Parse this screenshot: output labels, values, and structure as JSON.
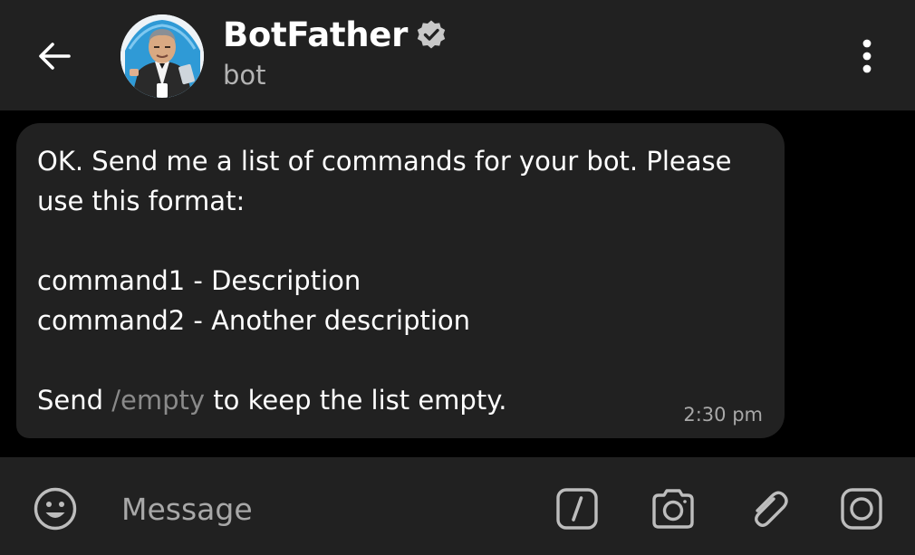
{
  "header": {
    "back_icon": "arrow-left-icon",
    "title": "BotFather",
    "verified_icon": "verified-badge-icon",
    "subtitle": "bot",
    "menu_icon": "more-vertical-icon"
  },
  "message": {
    "lines": [
      "OK. Send me a list of commands for your bot. Please",
      "use this format:",
      "",
      "command1 - Description",
      "command2 - Another description",
      ""
    ],
    "last_line": {
      "before": "Send ",
      "command": "/empty",
      "after": " to keep the list empty."
    },
    "time": "2:30 pm"
  },
  "input_bar": {
    "emoji_icon": "emoji-icon",
    "placeholder": "Message",
    "value": "",
    "commands_icon": "slash-commands-icon",
    "camera_icon": "camera-icon",
    "attach_icon": "paperclip-icon",
    "video_message_icon": "video-message-icon"
  },
  "colors": {
    "background": "#000000",
    "surface": "#212121",
    "text": "#ffffff",
    "muted": "#a8a8a8",
    "verified": "#c8c8c8"
  }
}
